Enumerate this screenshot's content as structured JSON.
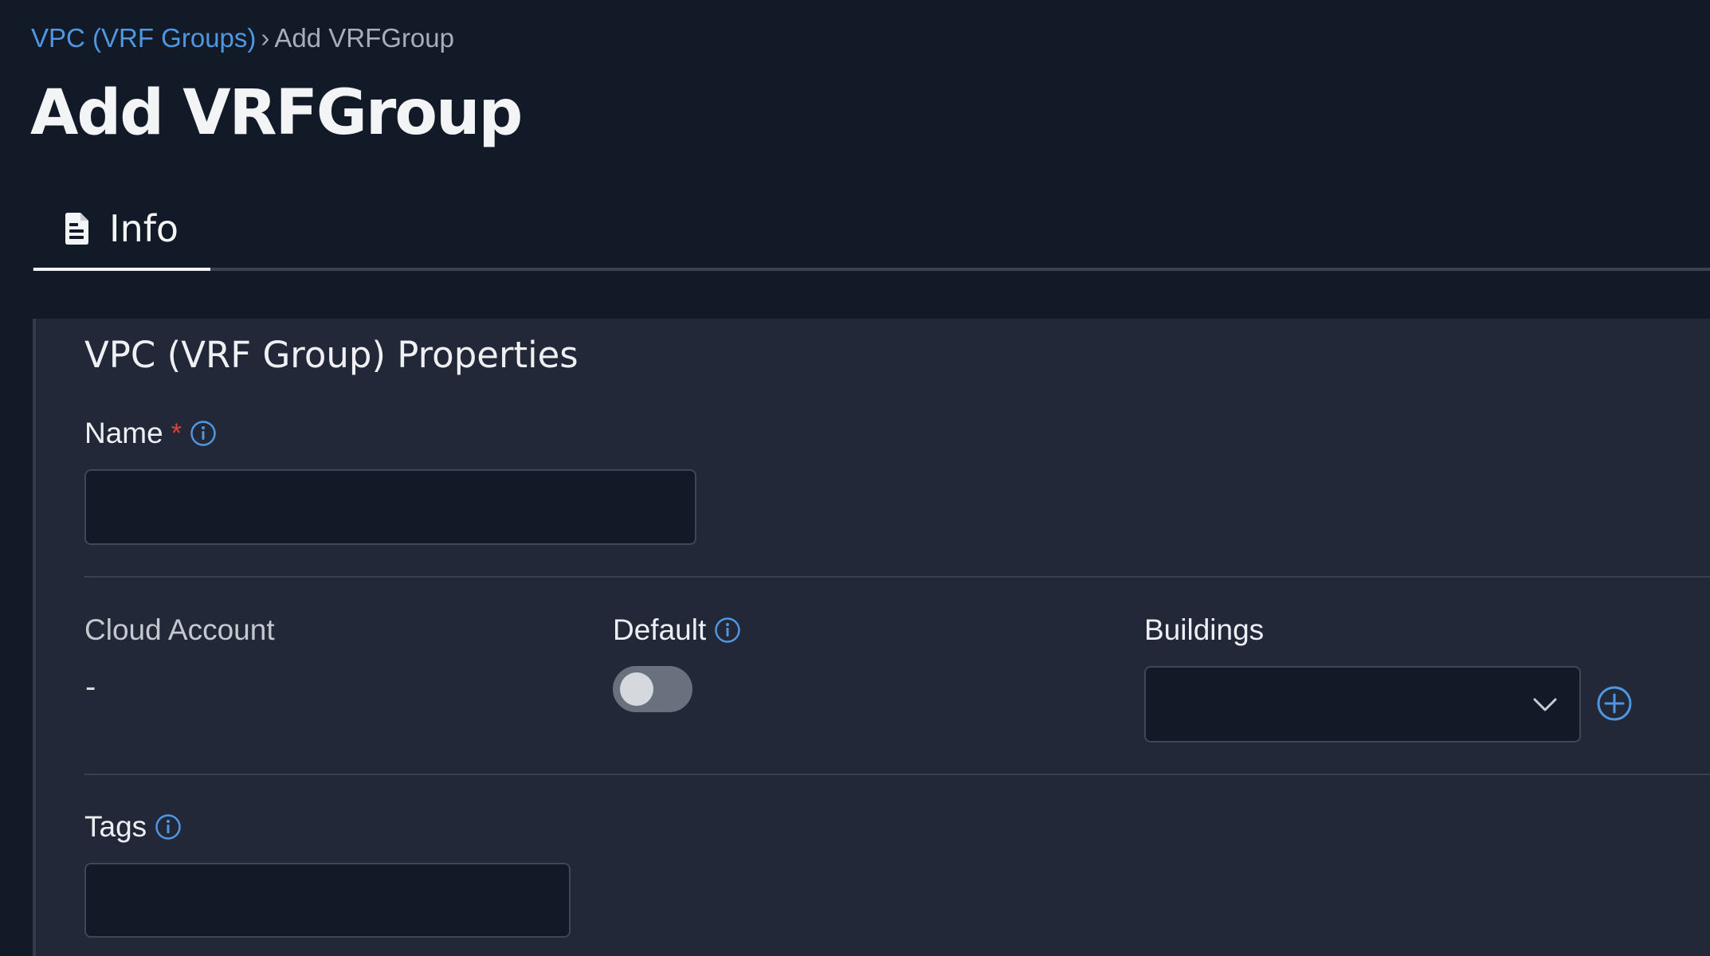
{
  "breadcrumb": {
    "parent_label": "VPC (VRF Groups)",
    "separator": "›",
    "current_label": "Add VRFGroup"
  },
  "page": {
    "title": "Add VRFGroup"
  },
  "tabs": [
    {
      "label": "Info",
      "icon": "document-icon",
      "active": true
    }
  ],
  "section": {
    "title": "VPC (VRF Group) Properties"
  },
  "fields": {
    "name": {
      "label": "Name",
      "required_marker": "*",
      "value": "",
      "placeholder": ""
    },
    "cloud_account": {
      "label": "Cloud Account",
      "value": "-"
    },
    "default": {
      "label": "Default",
      "enabled": false
    },
    "buildings": {
      "label": "Buildings",
      "selected": ""
    },
    "tags": {
      "label": "Tags",
      "value": "",
      "placeholder": ""
    }
  },
  "colors": {
    "background": "#131a27",
    "panel": "#222837",
    "link": "#4f97e0",
    "required": "#e0413b",
    "info_icon": "#4f97e0"
  }
}
